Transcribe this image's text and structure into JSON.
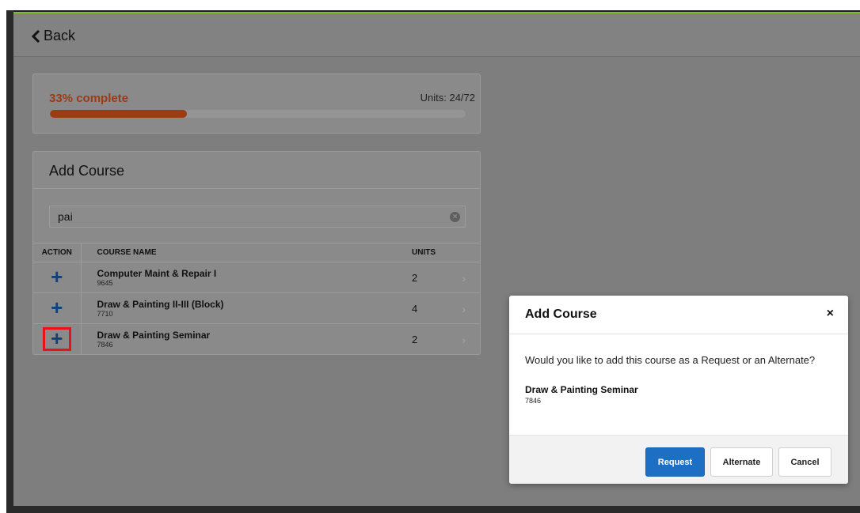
{
  "header": {
    "back_label": "Back"
  },
  "progress": {
    "percent_label": "33% complete",
    "units_label": "Units: 24/72",
    "fraction": 0.33,
    "color": "#9a3d12"
  },
  "add_course": {
    "title": "Add Course",
    "search": {
      "value": "pai",
      "placeholder": ""
    },
    "columns": {
      "action": "ACTION",
      "course_name": "COURSE NAME",
      "units": "UNITS"
    },
    "rows": [
      {
        "name": "Computer Maint & Repair I",
        "number": "9645",
        "units": "2"
      },
      {
        "name": "Draw & Painting II-III (Block)",
        "number": "7710",
        "units": "4"
      },
      {
        "name": "Draw & Painting Seminar",
        "number": "7846",
        "units": "2"
      }
    ],
    "highlight_color": "#e8101a"
  },
  "modal": {
    "title": "Add Course",
    "close": "×",
    "question": "Would you like to add this course as a Request or an Alternate?",
    "course_name": "Draw & Painting Seminar",
    "course_number": "7846",
    "request_label": "Request",
    "alternate_label": "Alternate",
    "cancel_label": "Cancel",
    "primary_color": "#1d6fc4"
  },
  "icons": {
    "back": "chevron-left-icon",
    "add": "plus-icon",
    "clear": "clear-circle-icon",
    "row_nav": "chevron-right-icon",
    "close": "close-icon"
  }
}
